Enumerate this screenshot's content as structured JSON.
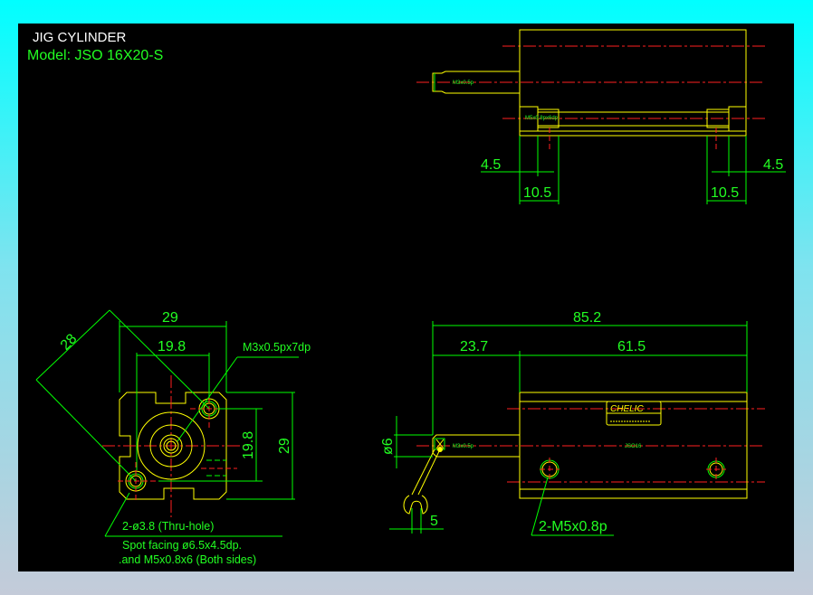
{
  "title": "JIG CYLINDER",
  "model": "Model:  JSO 16X20-S",
  "colors": {
    "background_top": "#00ffff",
    "background_bottom": "#c4cbd9",
    "canvas": "#000000",
    "outline": "#ffff00",
    "dimension": "#00ff00",
    "centerline": "#ff2020",
    "title": "#ffffff"
  },
  "top_view": {
    "rod_thread": "M3x0.5p",
    "port_thread": "M5x0.8px6dp",
    "dims": {
      "left_small": "4.5",
      "left_large": "10.5",
      "right_small": "4.5",
      "right_large": "10.5"
    }
  },
  "end_view": {
    "dims": {
      "diagonal": "28",
      "width": "29",
      "hole_pitch_h": "19.8",
      "hole_pitch_v": "19.8",
      "height": "29"
    },
    "rod_thread_note": "M3x0.5px7dp",
    "hole_note": [
      "2-ø3.8 (Thru-hole)",
      "Spot facing ø6.5x4.5dp.",
      ".and M5x0.8x6 (Both sides)"
    ]
  },
  "side_view": {
    "dims": {
      "overall": "85.2",
      "rod": "23.7",
      "body": "61.5",
      "rod_dia": "ø6",
      "wrench": "5"
    },
    "rod_thread": "M3x0.5p",
    "brand": "CHELIC",
    "body_mark": "JSO16",
    "port_note": "2-M5x0.8p"
  }
}
